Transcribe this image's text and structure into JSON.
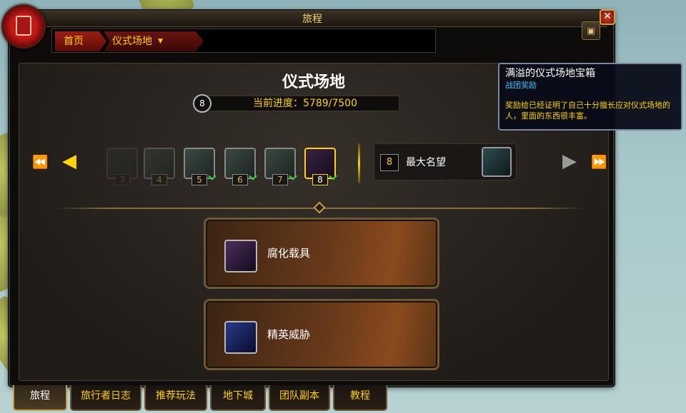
{
  "window": {
    "title": "旅程",
    "close_glyph": "✕"
  },
  "breadcrumb": {
    "home": "首页",
    "current": "仪式场地",
    "dropdown_glyph": "▼"
  },
  "map_button_glyph": "▣",
  "page": {
    "title": "仪式场地",
    "level_badge": "8",
    "progress_text": "当前进度：5789/7500",
    "progress": {
      "current": 5789,
      "max": 7500
    }
  },
  "tiers": [
    {
      "num": "3",
      "state": "ghost"
    },
    {
      "num": "4",
      "state": "faded"
    },
    {
      "num": "5",
      "state": "done"
    },
    {
      "num": "6",
      "state": "done"
    },
    {
      "num": "7",
      "state": "done"
    },
    {
      "num": "8",
      "state": "selected"
    }
  ],
  "nav": {
    "first": "⏪",
    "prev": "◀",
    "next": "▶",
    "last": "⏩"
  },
  "max_renown": {
    "level": "8",
    "label": "最大名望"
  },
  "rewards": [
    {
      "label": "腐化载具",
      "icon": "corrupted-vehicle-icon"
    },
    {
      "label": "精英威胁",
      "icon": "elite-threat-icon"
    }
  ],
  "tooltip": {
    "title": "满溢的仪式场地宝箱",
    "subtitle": "战团奖励",
    "description": "奖励给已经证明了自己十分擅长应对仪式场地的人，里面的东西很丰富。"
  },
  "tabs": [
    {
      "label": "旅程",
      "active": true
    },
    {
      "label": "旅行者日志",
      "active": false
    },
    {
      "label": "推荐玩法",
      "active": false
    },
    {
      "label": "地下城",
      "active": false
    },
    {
      "label": "团队副本",
      "active": false
    },
    {
      "label": "教程",
      "active": false
    }
  ],
  "colors": {
    "accent": "#ffd200",
    "tooltip_sub": "#3ac1ff",
    "check": "#3ad13a"
  }
}
